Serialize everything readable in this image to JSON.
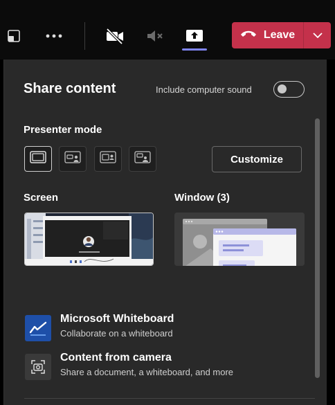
{
  "toolbar": {
    "icons": [
      "popout-icon",
      "more-icon",
      "camera-off-icon",
      "mic-muted-icon",
      "share-icon"
    ],
    "leave_label": "Leave",
    "leave_color": "#c4314b",
    "share_accent": "#7f85f5"
  },
  "panel": {
    "title": "Share content",
    "include_sound_label": "Include computer sound",
    "include_sound_on": false,
    "presenter_mode_label": "Presenter mode",
    "presenter_modes": [
      "content-only",
      "standout",
      "side-by-side",
      "reporter"
    ],
    "presenter_mode_selected": 0,
    "customize_label": "Customize",
    "screen_label": "Screen",
    "window_label": "Window (3)",
    "thumbnail_caption": "Waiting for others to join...",
    "items": [
      {
        "title": "Microsoft Whiteboard",
        "subtitle": "Collaborate on a whiteboard",
        "icon": "whiteboard-icon",
        "icon_bg": "#1e4fa8"
      },
      {
        "title": "Content from camera",
        "subtitle": "Share a document, a whiteboard, and more",
        "icon": "camera-capture-icon",
        "icon_bg": "#3a3a3a"
      }
    ]
  }
}
